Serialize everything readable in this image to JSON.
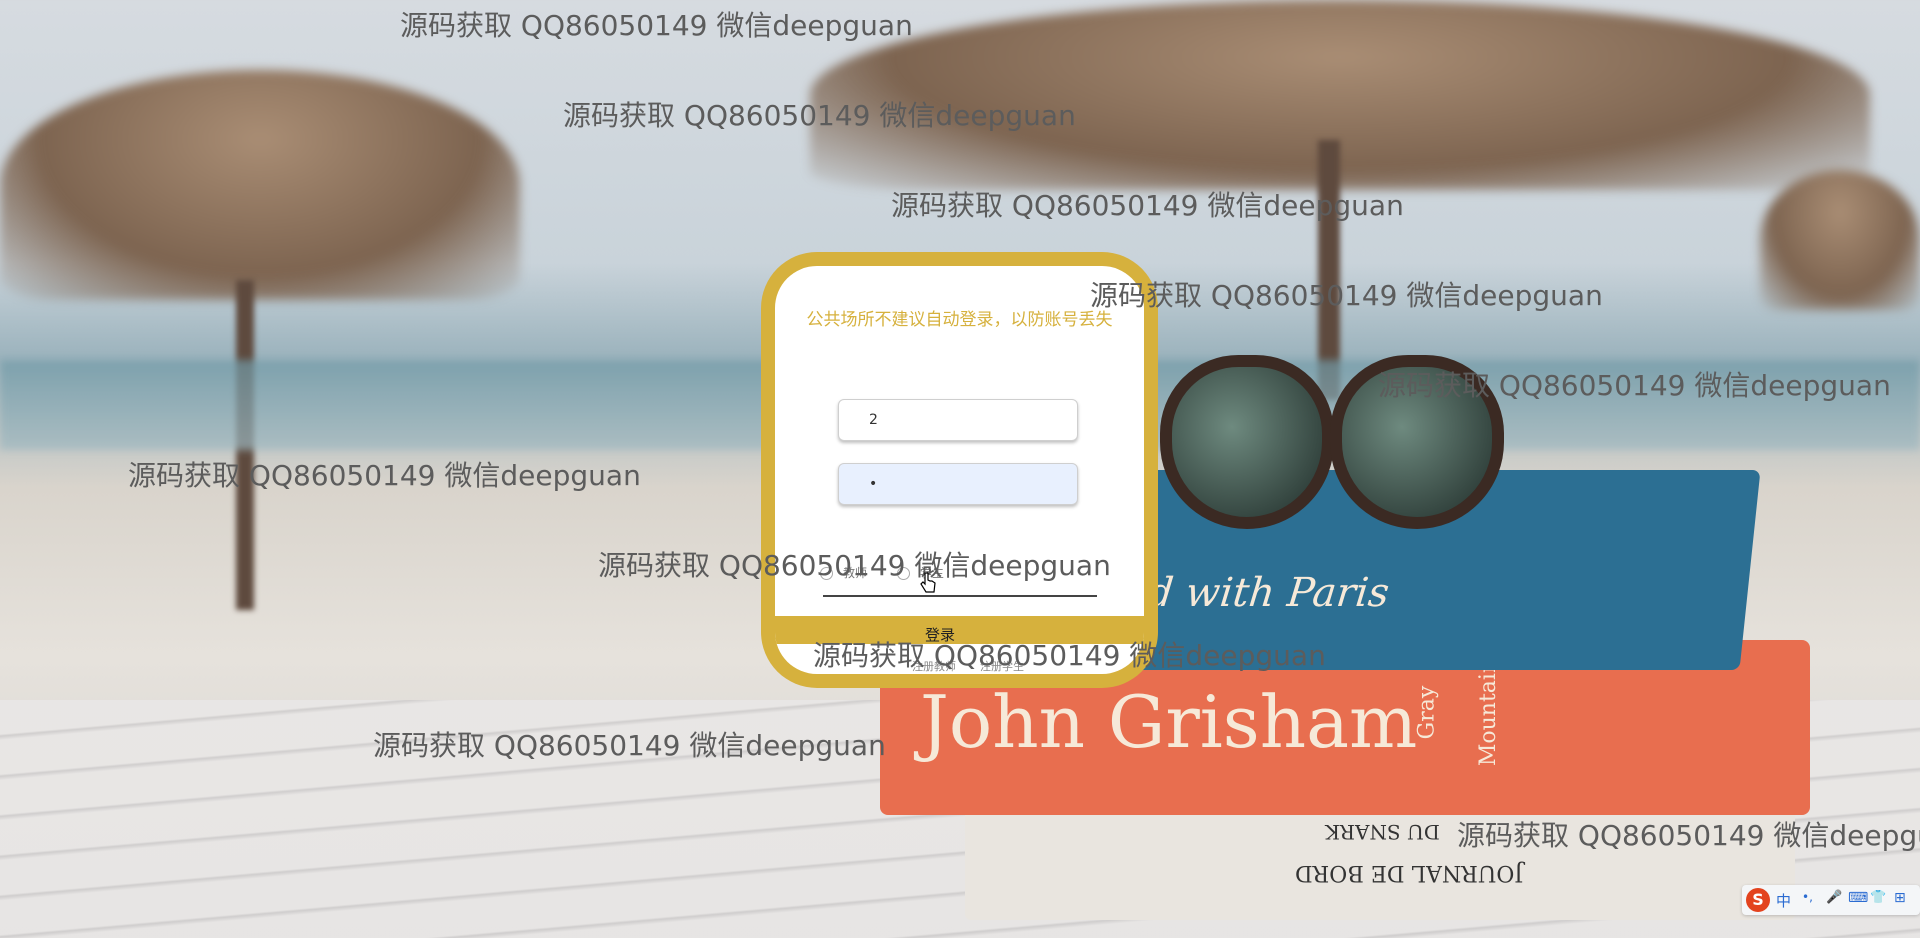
{
  "watermark": "源码获取 QQ86050149 微信deepguan",
  "background": {
    "book_blue_text": "d with Paris",
    "book_orange_text": "John Grisham",
    "book_orange_side1": "Gray",
    "book_orange_side2": "Mountain",
    "book_white_text1": "JOURNAL DE BORD",
    "book_white_text2": "DU SNARK"
  },
  "login": {
    "notice": "公共场所不建议自动登录，以防账号丢失",
    "username_value": "2",
    "password_value": "•",
    "roles": [
      "教师",
      "学生"
    ],
    "login_label": "登录",
    "register_teacher": "注册教师",
    "register_student": "注册学生"
  },
  "taskbar": {
    "ime_logo": "S",
    "ime_mode": "中",
    "ime_icons": [
      "•,",
      "🎤",
      "⌨",
      "👕",
      "⊞"
    ]
  },
  "colors": {
    "gold": "#d6b13d",
    "watermark": "#5c5c5c"
  }
}
